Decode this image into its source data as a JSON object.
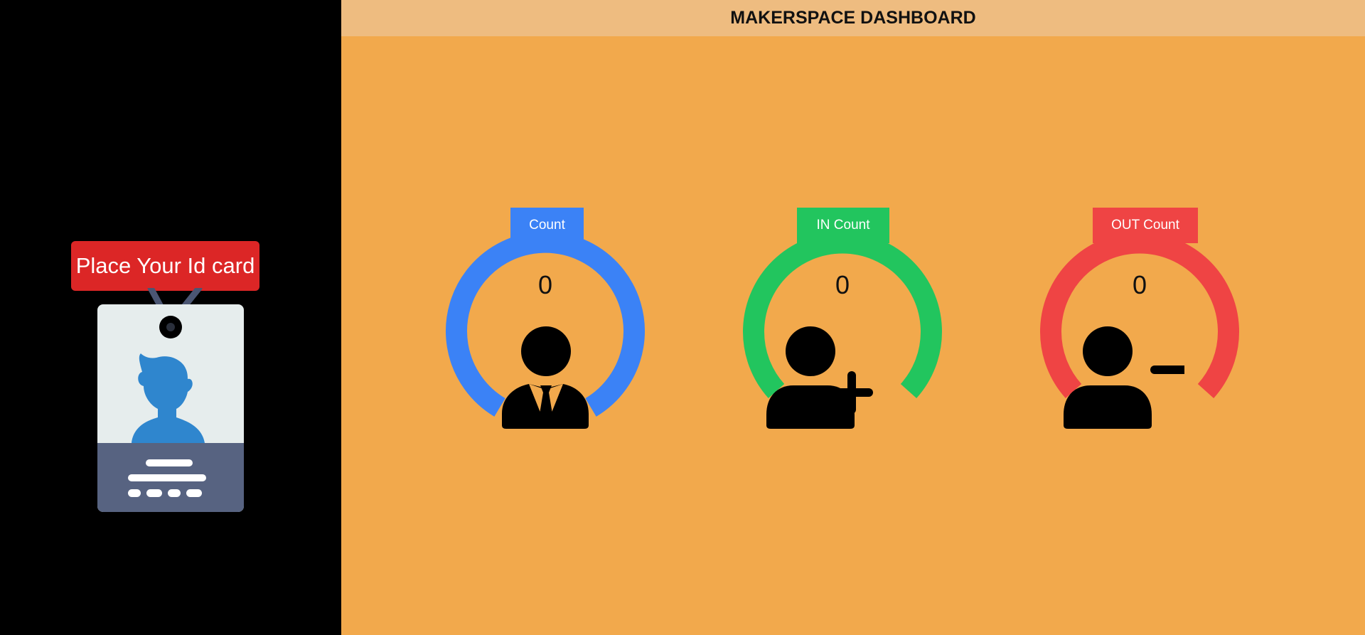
{
  "header": {
    "title": "MAKERSPACE DASHBOARD"
  },
  "left_panel": {
    "prompt": "Place Your Id card",
    "illustration_icon": "id-card-icon"
  },
  "gauges": [
    {
      "value": "0",
      "label": "Count",
      "color": "#3b82f6",
      "icon": "person-tie-icon"
    },
    {
      "value": "0",
      "label": "IN Count",
      "color": "#22c55e",
      "icon": "person-plus-icon"
    },
    {
      "value": "0",
      "label": "OUT Count",
      "color": "#ef4444",
      "icon": "person-minus-icon"
    }
  ],
  "colors": {
    "left_background": "#000000",
    "main_background": "#f2a94c",
    "header_background": "#eebc80",
    "prompt_background": "#dc2626"
  }
}
